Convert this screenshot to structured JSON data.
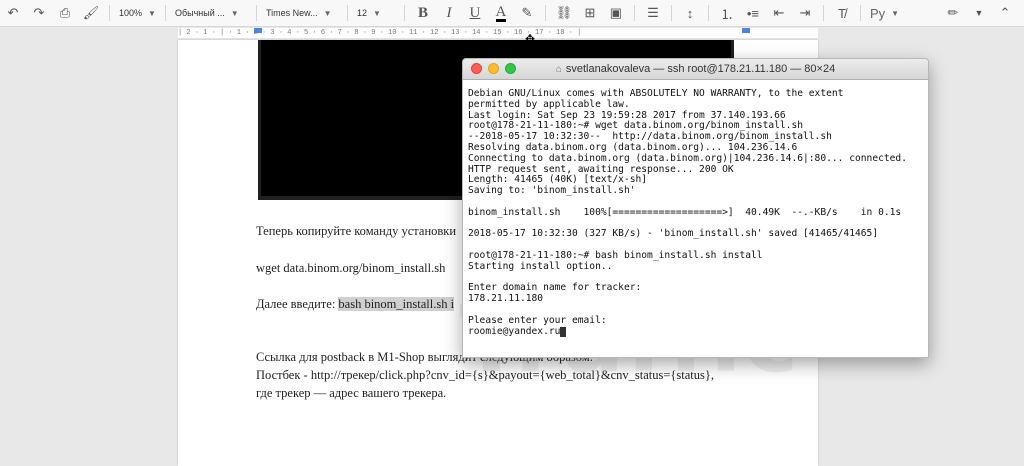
{
  "toolbar": {
    "zoom": "100%",
    "style": "Обычный ...",
    "font": "Times New...",
    "font_size": "12",
    "bold": "B",
    "italic": "I",
    "underline": "U",
    "text_color": "A",
    "input_lang": "Ру"
  },
  "ruler": {
    "text": "| 2 · 1 · | · 1 · 2 · 3 · 4 · 5 · 6 · 7 · 8 · 9 · 10 · 11 · 12 · 13 · 14 · 15 · 16 · 17 · 18 · |"
  },
  "document": {
    "line1": "Теперь копируйте команду установки",
    "line2": "wget data.binom.org/binom_install.sh",
    "line3_prefix": "Далее введите: ",
    "line3_highlight": "bash binom_install.sh i",
    "line4": "Ссылка для postback в M1-Shop выглядит следующим образом.",
    "line5": "Постбек - http://трекер/click.php?cnv_id={s}&payout={web_total}&cnv_status={status},",
    "line6": "где трекер — адрес вашего трекера."
  },
  "terminal": {
    "title": "svetlanakovaleva — ssh root@178.21.11.180 — 80×24",
    "lines": [
      "Debian GNU/Linux comes with ABSOLUTELY NO WARRANTY, to the extent",
      "permitted by applicable law.",
      "Last login: Sat Sep 23 19:59:28 2017 from 37.140.193.66",
      "root@178-21-11-180:~# wget data.binom.org/binom_install.sh",
      "--2018-05-17 10:32:30--  http://data.binom.org/binom_install.sh",
      "Resolving data.binom.org (data.binom.org)... 104.236.14.6",
      "Connecting to data.binom.org (data.binom.org)|104.236.14.6|:80... connected.",
      "HTTP request sent, awaiting response... 200 OK",
      "Length: 41465 (40K) [text/x-sh]",
      "Saving to: 'binom_install.sh'",
      "",
      "binom_install.sh    100%[===================>]  40.49K  --.-KB/s    in 0.1s",
      "",
      "2018-05-17 10:32:30 (327 KB/s) - 'binom_install.sh' saved [41465/41465]",
      "",
      "root@178-21-11-180:~# bash binom_install.sh install",
      "Starting install option..",
      "",
      "Enter domain name for tracker:",
      "178.21.11.180",
      "",
      "Please enter your email:",
      "roomie@yandex.ru"
    ]
  },
  "watermark": "Traffic"
}
